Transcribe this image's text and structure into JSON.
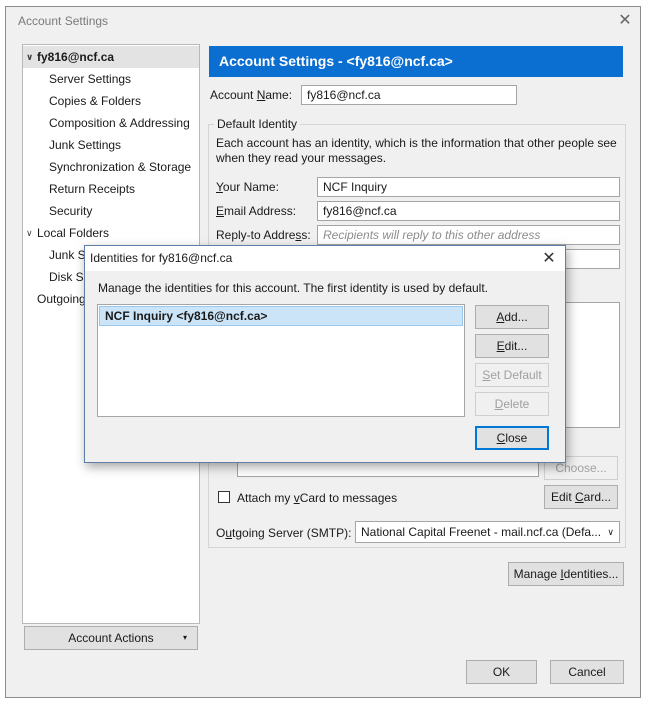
{
  "window": {
    "title": "Account Settings",
    "close_glyph": "✕"
  },
  "tree": {
    "account": "fy816@ncf.ca",
    "account_items": [
      "Server Settings",
      "Copies & Folders",
      "Composition & Addressing",
      "Junk Settings",
      "Synchronization & Storage",
      "Return Receipts",
      "Security"
    ],
    "local_folders": "Local Folders",
    "local_items": [
      "Junk Se",
      "Disk Sp"
    ],
    "outgoing": "Outgoing",
    "expanded_glyph": "∨"
  },
  "account_actions": {
    "label": "Account Actions",
    "dropdown_glyph": "▾"
  },
  "main": {
    "header": "Account Settings - <fy816@ncf.ca>",
    "account_name": {
      "label_u": "N",
      "label_pre": "Account ",
      "label_post": "ame:",
      "value": "fy816@ncf.ca"
    },
    "default_identity": {
      "legend": "Default Identity",
      "description": "Each account has an identity, which is the information that other people see when they read your messages.",
      "your_name": {
        "label_u": "Y",
        "label_post": "our Name:",
        "value": "NCF Inquiry"
      },
      "email": {
        "label_u": "E",
        "label_post": "mail Address:",
        "value": "fy816@ncf.ca"
      },
      "reply_to": {
        "label_pre": "Reply-to Addre",
        "label_u": "s",
        "label_post": "s:",
        "placeholder": "Recipients will reply to this other address"
      }
    },
    "choose_label": "Choose...",
    "attach_vcard": {
      "label_pre": "Attach my ",
      "label_u": "v",
      "label_post": "Card to messages",
      "checked": false
    },
    "edit_card": {
      "label_pre": "Edit ",
      "label_u": "C",
      "label_post": "ard..."
    },
    "outgoing_server": {
      "label_pre": "O",
      "label_u": "u",
      "label_post": "tgoing Server (SMTP):",
      "value": "National Capital Freenet - mail.ncf.ca (Defa...",
      "dropdown_glyph": "∨"
    },
    "manage_identities": {
      "label_pre": "Manage ",
      "label_u": "I",
      "label_post": "dentities..."
    }
  },
  "footer": {
    "ok": "OK",
    "cancel": "Cancel"
  },
  "dialog": {
    "title": "Identities for fy816@ncf.ca",
    "close_glyph": "✕",
    "description": "Manage the identities for this account. The first identity is used by default.",
    "identities": [
      "NCF Inquiry <fy816@ncf.ca>"
    ],
    "buttons": {
      "add": {
        "u": "A",
        "post": "dd..."
      },
      "edit": {
        "u": "E",
        "post": "dit..."
      },
      "set_default": {
        "u": "S",
        "post": "et Default"
      },
      "delete": {
        "u": "D",
        "post": "elete"
      },
      "close": {
        "u": "C",
        "post": "lose"
      }
    }
  },
  "colors": {
    "header_bg": "#0b6fd1",
    "selection_bg": "#cce4f7",
    "dialog_border": "#5e7ea8"
  }
}
